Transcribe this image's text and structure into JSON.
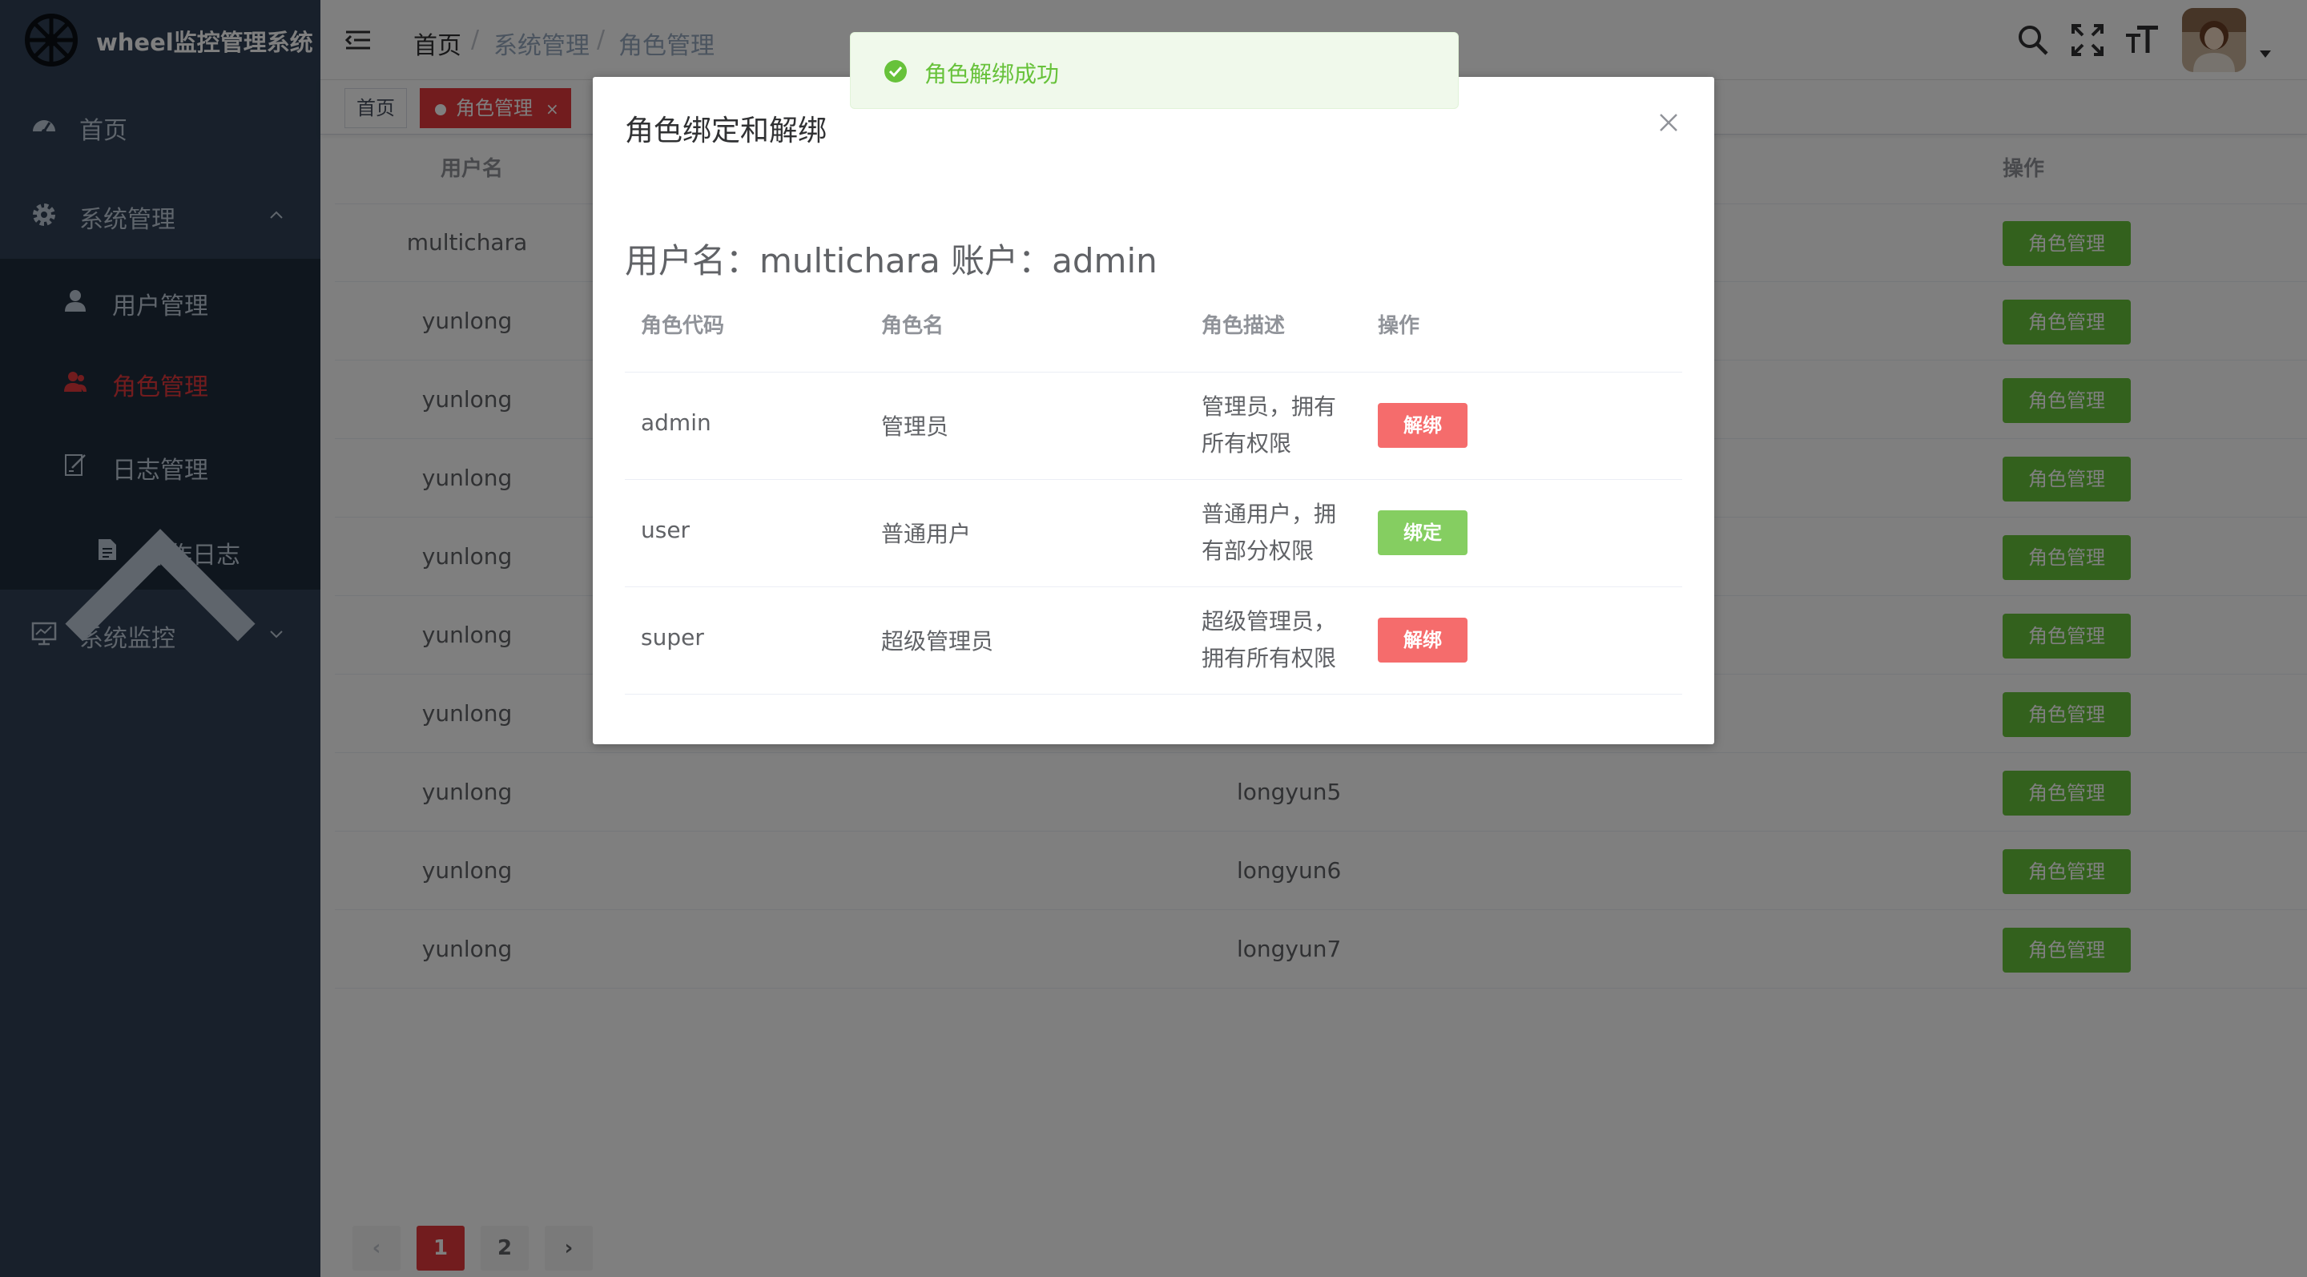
{
  "app": {
    "title": "wheel监控管理系统"
  },
  "sidebar": {
    "home": "首页",
    "system": "系统管理",
    "user_mgmt": "用户管理",
    "role_mgmt": "角色管理",
    "log_mgmt": "日志管理",
    "op_log": "操作日志",
    "monitor": "系统监控"
  },
  "breadcrumb": [
    "首页",
    "系统管理",
    "角色管理"
  ],
  "tags": {
    "home": "首页",
    "active": "角色管理",
    "close": "×"
  },
  "table": {
    "col_username": "用户名",
    "col_action": "操作",
    "action_label": "角色管理",
    "rows": [
      {
        "username": "multichara",
        "account": ""
      },
      {
        "username": "yunlong",
        "account": ""
      },
      {
        "username": "yunlong",
        "account": ""
      },
      {
        "username": "yunlong",
        "account": ""
      },
      {
        "username": "yunlong",
        "account": ""
      },
      {
        "username": "yunlong",
        "account": ""
      },
      {
        "username": "yunlong",
        "account": ""
      },
      {
        "username": "yunlong",
        "account": "longyun5"
      },
      {
        "username": "yunlong",
        "account": "longyun6"
      },
      {
        "username": "yunlong",
        "account": "longyun7"
      }
    ]
  },
  "pagination": {
    "prev": "‹",
    "pages": [
      "1",
      "2"
    ],
    "current": "1",
    "next": "›"
  },
  "dialog": {
    "title": "角色绑定和解绑",
    "info": "用户名：multichara 账户：admin",
    "headers": {
      "code": "角色代码",
      "name": "角色名",
      "desc": "角色描述",
      "action": "操作"
    },
    "rows": [
      {
        "code": "admin",
        "name": "管理员",
        "desc": "管理员，拥有所有权限",
        "action": "解绑",
        "action_type": "unbind"
      },
      {
        "code": "user",
        "name": "普通用户",
        "desc": "普通用户，拥有部分权限",
        "action": "绑定",
        "action_type": "bind"
      },
      {
        "code": "super",
        "name": "超级管理员",
        "desc": "超级管理员，拥有所有权限",
        "action": "解绑",
        "action_type": "unbind"
      }
    ]
  },
  "toast": {
    "message": "角色解绑成功",
    "type": "success"
  },
  "colors": {
    "sidebar_bg": "#304156",
    "submenu_bg": "#1f2d3d",
    "accent_red": "#e4393c",
    "success_green": "#67c23a",
    "danger": "#f56c6c"
  }
}
